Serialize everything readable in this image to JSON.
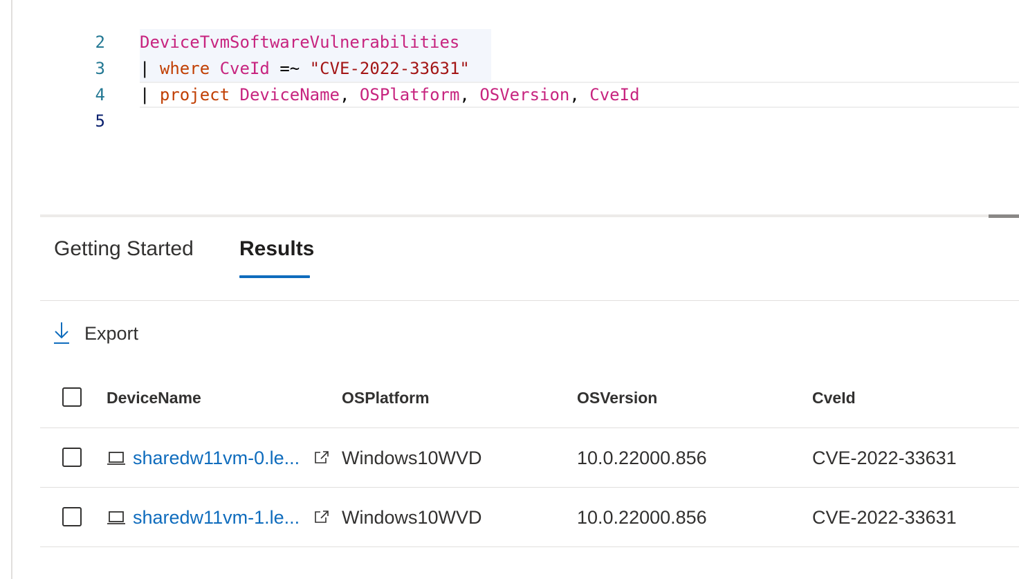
{
  "editor": {
    "lines": [
      {
        "num": "2"
      },
      {
        "num": "3",
        "table": "DeviceTvmSoftwareVulnerabilities"
      },
      {
        "num": "4",
        "pipe": "|",
        "keyword": "where",
        "column": "CveId",
        "operator": "=~",
        "string": "\"CVE-2022-33631\""
      },
      {
        "num": "5",
        "pipe": "|",
        "keyword": "project",
        "columns": [
          "DeviceName",
          "OSPlatform",
          "OSVersion",
          "CveId"
        ],
        "sep": ","
      }
    ]
  },
  "tabs": [
    {
      "label": "Getting Started",
      "active": false
    },
    {
      "label": "Results",
      "active": true
    }
  ],
  "toolbar": {
    "export_label": "Export",
    "export_icon": "download-icon"
  },
  "table": {
    "columns": [
      "DeviceName",
      "OSPlatform",
      "OSVersion",
      "CveId"
    ],
    "rows": [
      {
        "DeviceName": "sharedw11vm-0.le...",
        "OSPlatform": "Windows10WVD",
        "OSVersion": "10.0.22000.856",
        "CveId": "CVE-2022-33631"
      },
      {
        "DeviceName": "sharedw11vm-1.le...",
        "OSPlatform": "Windows10WVD",
        "OSVersion": "10.0.22000.856",
        "CveId": "CVE-2022-33631"
      }
    ]
  },
  "colors": {
    "accent": "#0f6cbd",
    "table_name": "#c7247f",
    "keyword": "#c13f03",
    "line_number": "#237893"
  }
}
